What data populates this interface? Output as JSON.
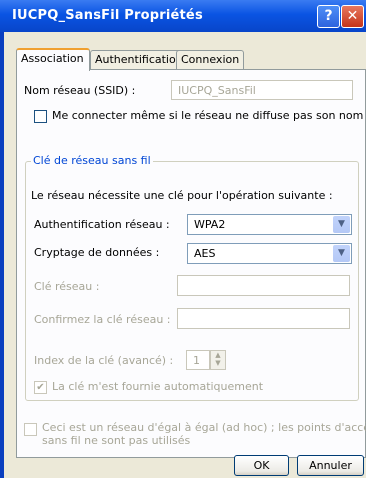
{
  "window": {
    "title": "IUCPQ_SansFil Propriétés",
    "help_glyph": "?",
    "close_glyph": "✕"
  },
  "tabs": [
    {
      "label": "Association",
      "active": true
    },
    {
      "label": "Authentification",
      "active": false
    },
    {
      "label": "Connexion",
      "active": false
    }
  ],
  "association": {
    "ssid_label": "Nom réseau (SSID) :",
    "ssid_value": "IUCPQ_SansFil",
    "hidden_network_label": "Me connecter même si le réseau ne diffuse pas son nom",
    "hidden_network_checked": false,
    "group_title": "Clé de réseau sans fil",
    "group_description": "Le réseau nécessite une clé pour l'opération suivante :",
    "auth_label": "Authentification réseau :",
    "auth_value": "WPA2",
    "encryption_label": "Cryptage de données :",
    "encryption_value": "AES",
    "key_label": "Clé réseau :",
    "confirm_key_label": "Confirmez la clé réseau :",
    "key_index_label": "Index de la clé (avancé) :",
    "key_index_value": "1",
    "auto_key_label": "La clé m'est fournie automatiquement",
    "auto_key_checked": true,
    "adhoc_label_line1": "Ceci est un réseau d'égal à égal (ad hoc) ; les points d'accès",
    "adhoc_label_line2": "sans fil ne sont pas utilisés",
    "adhoc_checked": false
  },
  "buttons": {
    "ok": "OK",
    "cancel": "Annuler"
  },
  "colors": {
    "titlebar": "#0a54e3",
    "dialog_bg": "#ece9d8",
    "group_title": "#0046d5"
  }
}
